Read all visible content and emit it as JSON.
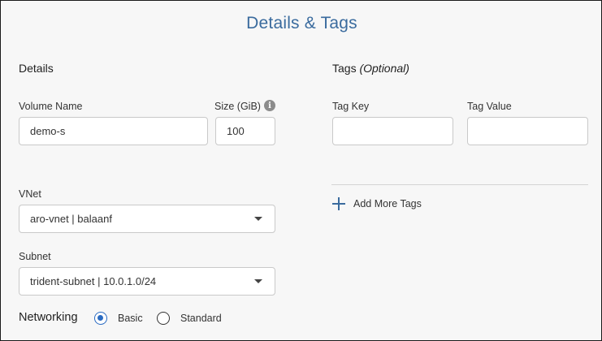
{
  "page": {
    "title": "Details & Tags"
  },
  "details": {
    "heading": "Details",
    "volume_name": {
      "label": "Volume Name",
      "value": "demo-s"
    },
    "size": {
      "label": "Size (GiB)",
      "value": "100",
      "info_icon": "info-icon"
    },
    "vnet": {
      "label": "VNet",
      "value": "aro-vnet | balaanf"
    },
    "subnet": {
      "label": "Subnet",
      "value": "trident-subnet | 10.0.1.0/24"
    },
    "networking": {
      "label": "Networking",
      "options": [
        {
          "label": "Basic",
          "selected": true
        },
        {
          "label": "Standard",
          "selected": false
        }
      ]
    }
  },
  "tags": {
    "heading": "Tags",
    "heading_optional": "(Optional)",
    "tag_key": {
      "label": "Tag Key",
      "value": ""
    },
    "tag_value": {
      "label": "Tag Value",
      "value": ""
    },
    "add_more_label": "Add More Tags"
  },
  "colors": {
    "title": "#3a6b9e",
    "accent": "#2a6bc2",
    "background": "#f7f7f7"
  }
}
